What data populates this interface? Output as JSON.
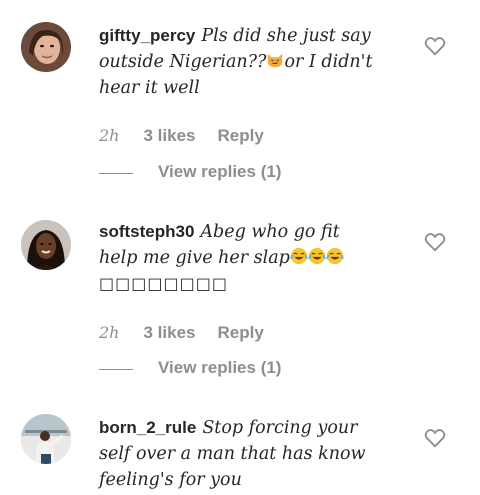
{
  "comments": [
    {
      "username": "giftty_percy",
      "text_line1": "Pls did she just say",
      "text_line2": "outside Nigerian??",
      "text_line2_after_emoji": "or I didn't",
      "text_line3": "hear it well",
      "emoji": "smiling-cat-face-with-open-mouth",
      "time": "2h",
      "likes": "3 likes",
      "reply_label": "Reply",
      "view_replies": "View replies (1)",
      "avatar_icon": "user-avatar-icon"
    },
    {
      "username": "softsteph30",
      "text_line1": "Abeg who go fit",
      "text_line2": "help me give her slap",
      "emoji": "face-with-tears-of-joy",
      "emoji_count": 3,
      "text_line3": "□□□□□□□□",
      "time": "2h",
      "likes": "3 likes",
      "reply_label": "Reply",
      "view_replies": "View replies (1)",
      "avatar_icon": "user-avatar-icon"
    },
    {
      "username": "born_2_rule",
      "text_line1": "Stop forcing your",
      "text_line2": "self over a man that has know",
      "text_line3": "feeling's for you",
      "avatar_icon": "user-avatar-icon"
    }
  ],
  "colors": {
    "text": "#262626",
    "meta": "#8e8e8e",
    "background": "#ffffff"
  },
  "icons": {
    "like": "heart-outline-icon"
  }
}
